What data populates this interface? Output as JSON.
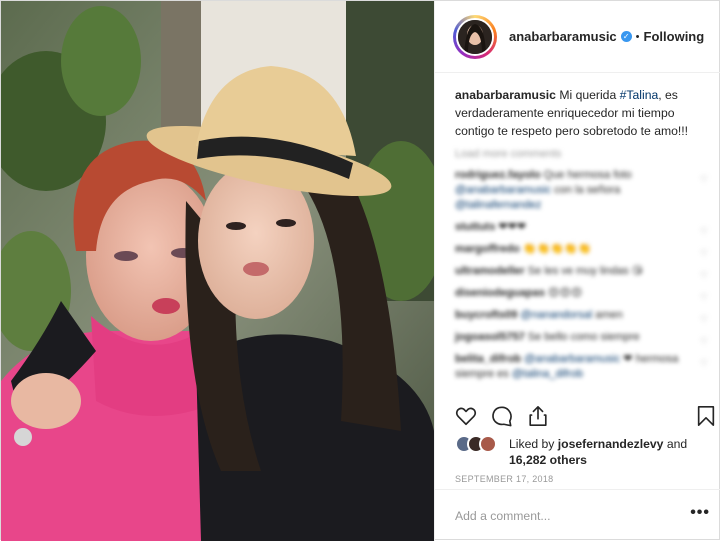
{
  "post": {
    "username": "anabarbaramusic",
    "verified_mark": "✓",
    "separator": "•",
    "follow_status": "Following",
    "caption": {
      "username": "anabarbaramusic",
      "text_before": " Mi querida ",
      "hashtag": "#Talina",
      "text_after": ", es verdaderamente enriquecedor mi tiempo contigo te respeto pero sobretodo te amo!!!"
    },
    "load_more": "Load more comments",
    "comments": [
      {
        "username": "rodriguez.fayolo",
        "text": " Que hermosa foto ",
        "mention": "@anabarbaramusic",
        "text2": " con la señora ",
        "mention2": "@talinafernandez"
      },
      {
        "username": "stuttuts",
        "text": " ❤❤❤",
        "mention": "",
        "text2": "",
        "mention2": ""
      },
      {
        "username": "margoffredo",
        "text": " 👏👏👏👏👏",
        "mention": "",
        "text2": "",
        "mention2": ""
      },
      {
        "username": "ultramodeller",
        "text": " Se les ve muy lindas 😘",
        "mention": "",
        "text2": "",
        "mention2": ""
      },
      {
        "username": "diseniodeguapas",
        "text": " 😍😍😍",
        "mention": "",
        "text2": "",
        "mention2": ""
      },
      {
        "username": "buycrofts09",
        "text": " ",
        "mention": "@nanandorsal",
        "text2": " amen",
        "mention2": ""
      },
      {
        "username": "jogoasol5757",
        "text": " Se bello como siempre",
        "mention": "",
        "text2": "",
        "mention2": ""
      },
      {
        "username": "belita_difrob",
        "text": " ",
        "mention": "@anabarbaramusic",
        "text2": " ❤ hermosa siempre es ",
        "mention2": "@talina_difrob"
      }
    ],
    "likes": {
      "prefix": "Liked by ",
      "user": "josefernandezlevy",
      "mid": " and ",
      "others": "16,282 others"
    },
    "date": "SEPTEMBER 17, 2018",
    "comment_placeholder": "Add a comment...",
    "more_label": "•••",
    "icons": [
      "heart-icon",
      "comment-icon",
      "share-icon",
      "bookmark-icon"
    ],
    "colors": {
      "link": "#003569",
      "verified": "#3897f0",
      "muted": "#999999",
      "text": "#262626",
      "border": "#efefef"
    }
  }
}
